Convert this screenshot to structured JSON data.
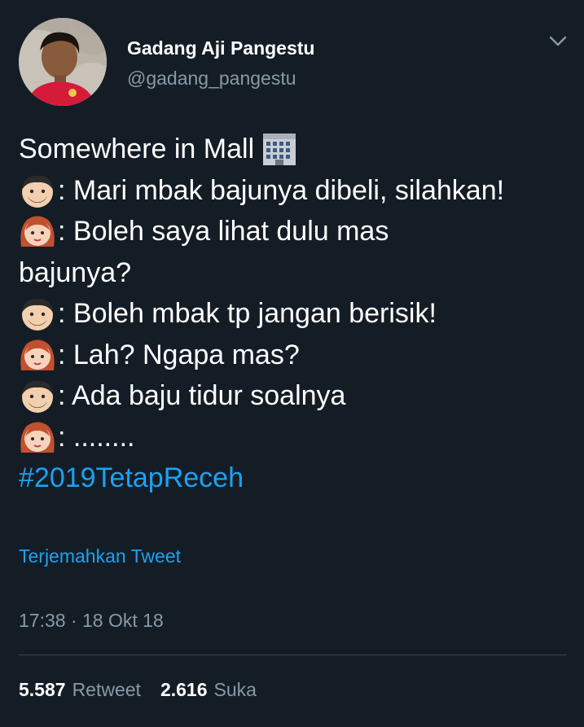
{
  "author": {
    "display_name": "Gadang Aji Pangestu",
    "handle": "@gadang_pangestu"
  },
  "tweet": {
    "lines": [
      {
        "speaker": "none",
        "text": "Somewhere in Mall",
        "trailing_icon": "office-building-emoji"
      },
      {
        "speaker": "man-emoji",
        "text": ": Mari mbak bajunya dibeli, silahkan!"
      },
      {
        "speaker": "woman-emoji",
        "text": ": Boleh saya lihat dulu mas"
      },
      {
        "speaker": "none",
        "text": "bajunya?"
      },
      {
        "speaker": "man-emoji",
        "text": ": Boleh mbak tp jangan berisik!"
      },
      {
        "speaker": "woman-emoji",
        "text": ": Lah? Ngapa mas?"
      },
      {
        "speaker": "man-emoji",
        "text": ": Ada baju tidur soalnya"
      },
      {
        "speaker": "woman-emoji",
        "text": ": ........"
      }
    ],
    "hashtag": "#2019TetapReceh"
  },
  "translate_link": "Terjemahkan Tweet",
  "timestamp": "17:38 · 18 Okt 18",
  "stats": {
    "retweets_count": "5.587",
    "retweets_label": "Retweet",
    "likes_count": "2.616",
    "likes_label": "Suka"
  },
  "colors": {
    "background": "#141d26",
    "text": "#ffffff",
    "muted": "#8899a6",
    "link": "#1da1f2",
    "divider": "#38444d"
  }
}
